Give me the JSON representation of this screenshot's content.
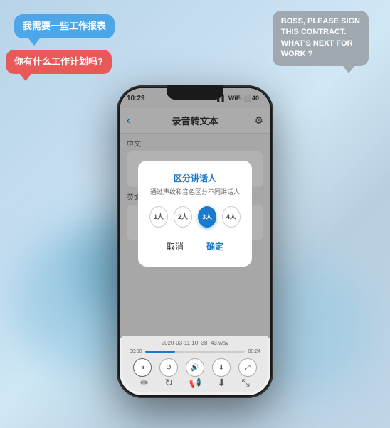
{
  "background": {
    "color_start": "#b8d4e8",
    "color_end": "#c0d5e8"
  },
  "bubbles": {
    "blue": {
      "text": "我需要一些工作报表",
      "color": "#4da6e8"
    },
    "red": {
      "text": "你有什么工作计划吗?",
      "color": "#e85a5a"
    },
    "gray": {
      "line1": "BOSS, PLEASE SIGN",
      "line2": "THIS CONTRACT.",
      "line3": "WHAT'S NEXT FOR",
      "line4": "WORK ?",
      "color": "#a0a8b0"
    }
  },
  "phone": {
    "status_bar": {
      "time": "10:29",
      "signal": "▌▌",
      "wifi": "WiFi",
      "battery": "40"
    },
    "nav": {
      "back_icon": "‹",
      "title": "录音转文本",
      "settings_icon": "⚙"
    },
    "content": {
      "chinese_label": "中文",
      "english_label": "英文"
    },
    "dialog": {
      "title": "区分讲话人",
      "subtitle": "通过声纹和音色区分不同讲话人",
      "options": [
        "1人",
        "2人",
        "3人",
        "4人"
      ],
      "active_option_index": 2,
      "cancel_label": "取消",
      "confirm_label": "确定"
    },
    "bottom_bar": {
      "file_name": "2020-03-11 10_38_43.wav",
      "time_elapsed": "00:00",
      "time_total": "00:24",
      "play_icon": "⏸",
      "rewind_icon": "↺",
      "volume_icon": "🔊",
      "save_icon": "💾",
      "expand_icon": "⤢",
      "edit_icon": "✏",
      "refresh_icon": "↻",
      "speaker_icon": "📢",
      "download_icon": "⬇",
      "arrows_icon": "⤡"
    }
  }
}
